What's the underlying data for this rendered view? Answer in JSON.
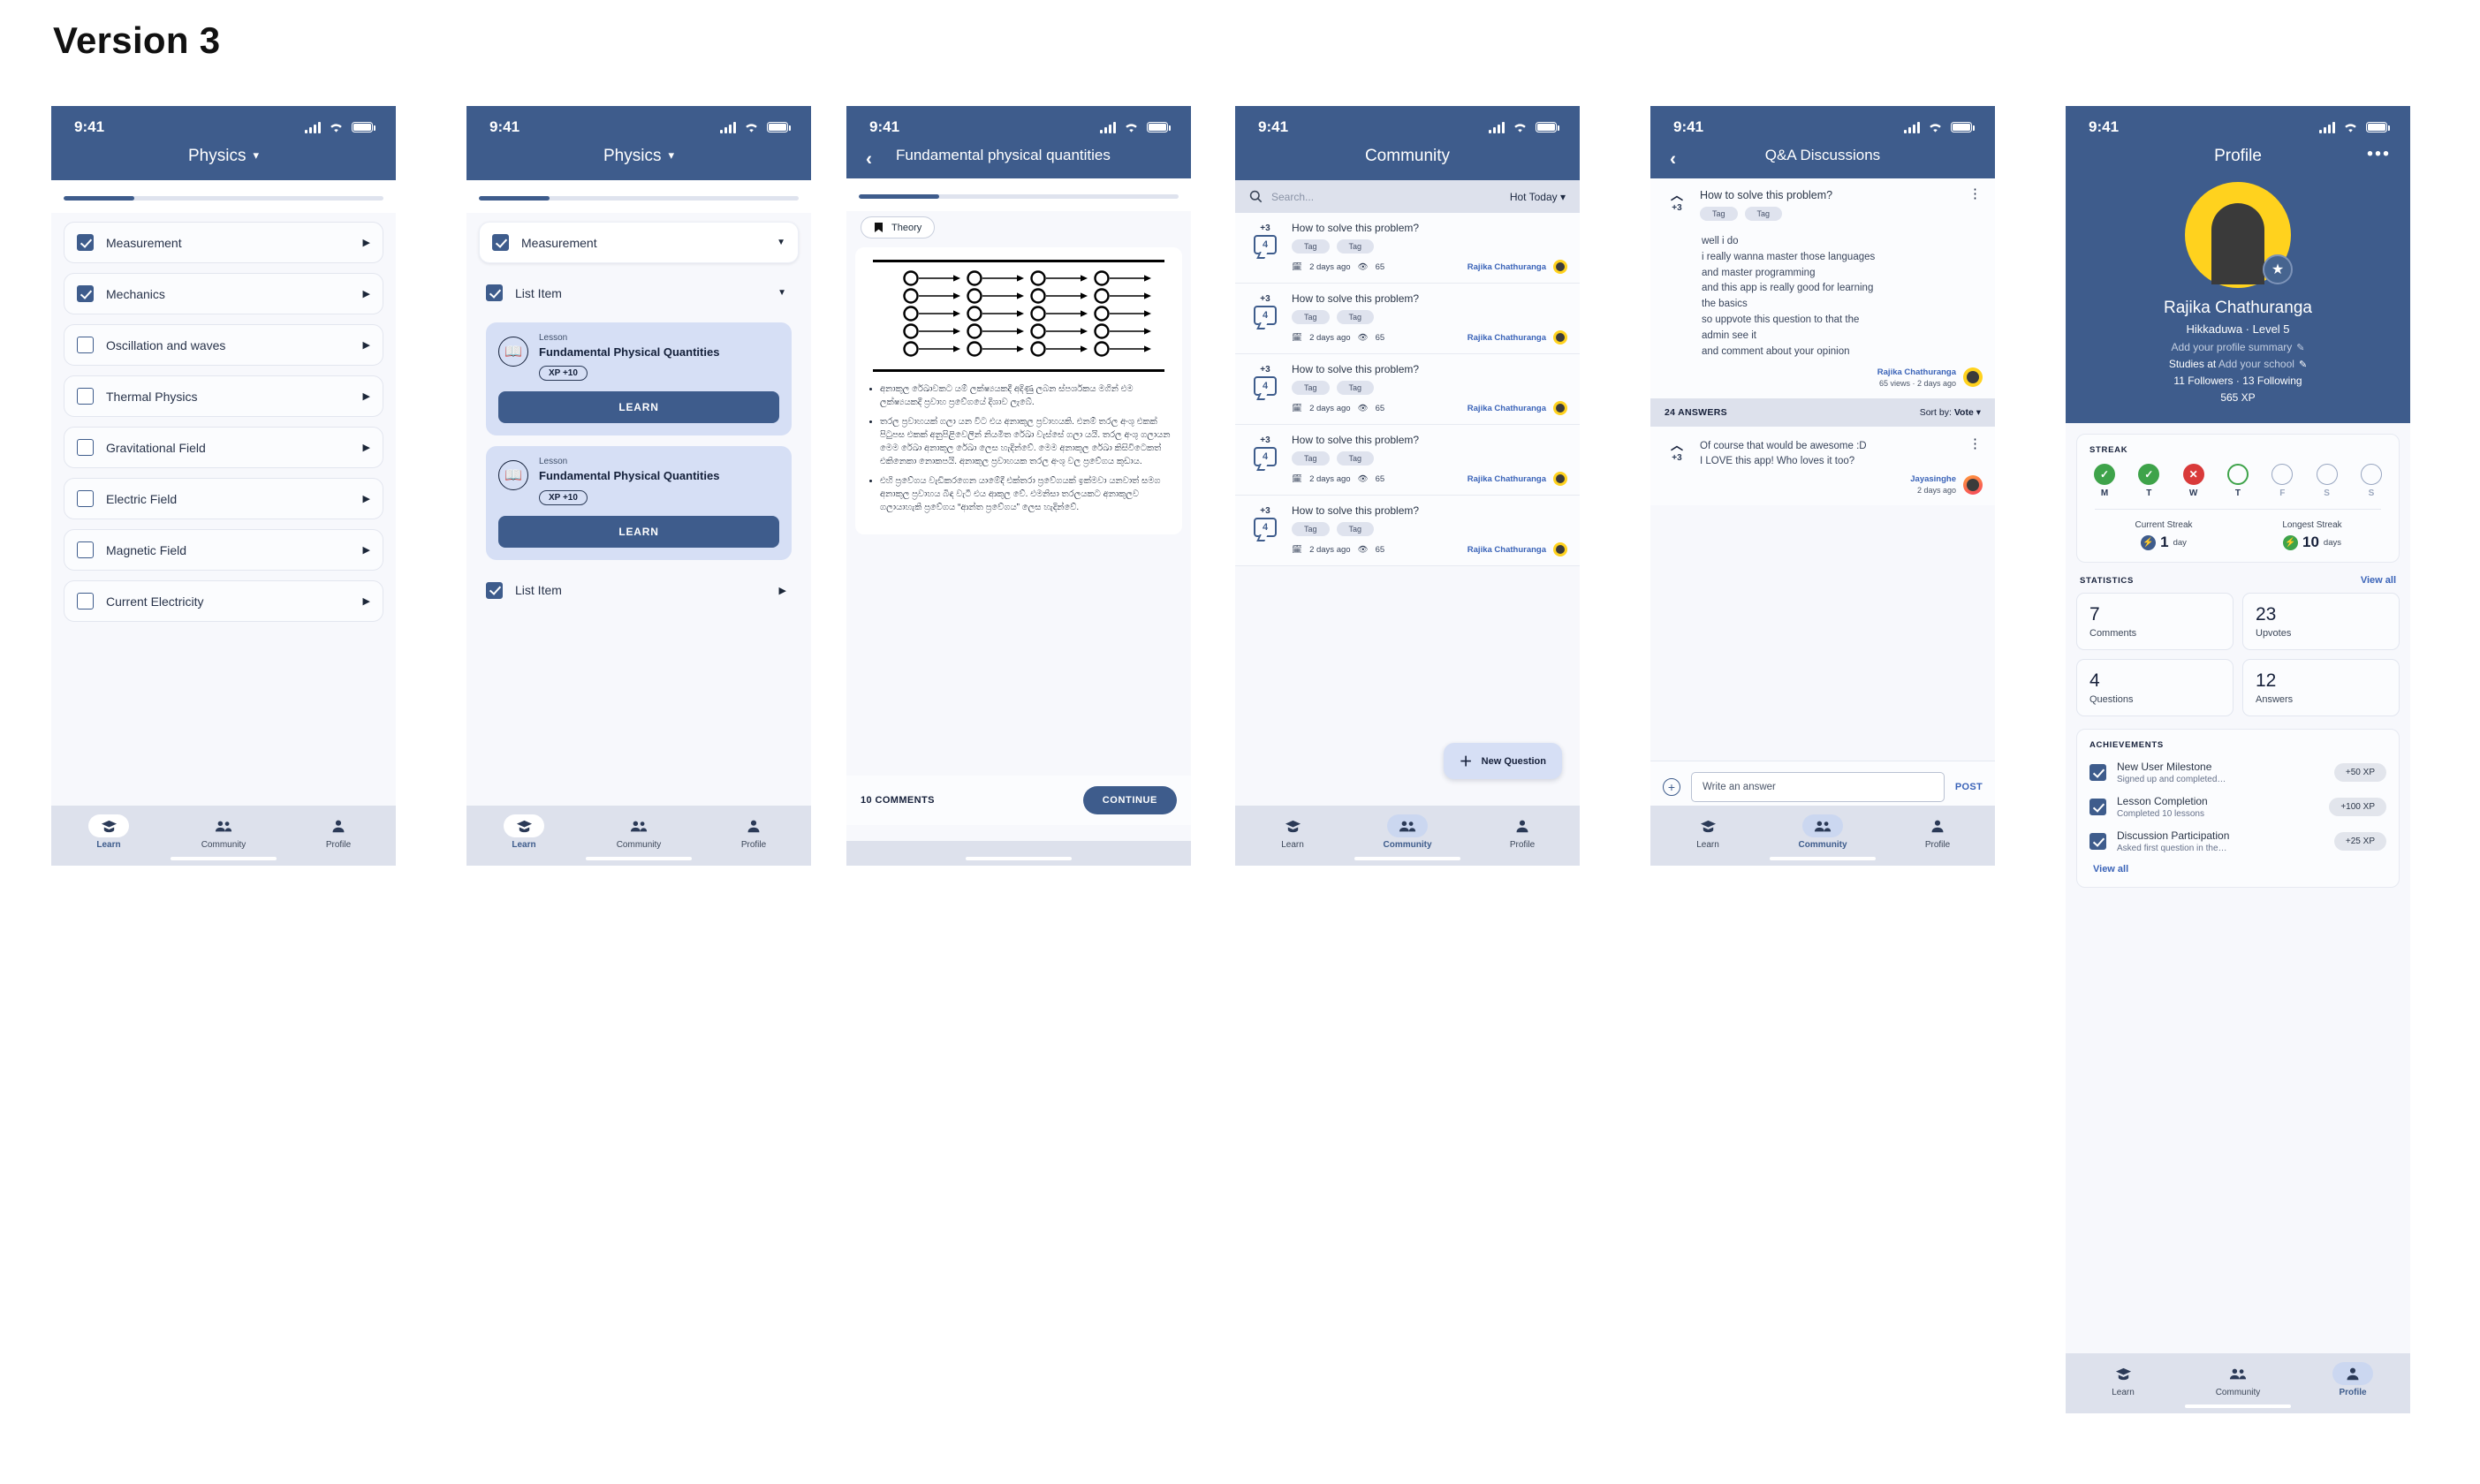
{
  "page_title": "Version 3",
  "status_bar": {
    "time": "9:41"
  },
  "screen1": {
    "title": "Physics",
    "progress_percent": 22,
    "items": [
      {
        "label": "Measurement",
        "checked": true
      },
      {
        "label": "Mechanics",
        "checked": true
      },
      {
        "label": "Oscillation and waves",
        "checked": false
      },
      {
        "label": "Thermal Physics",
        "checked": false
      },
      {
        "label": "Gravitational Field",
        "checked": false
      },
      {
        "label": "Electric Field",
        "checked": false
      },
      {
        "label": "Magnetic Field",
        "checked": false
      },
      {
        "label": "Current Electricity",
        "checked": false
      }
    ],
    "nav": [
      {
        "label": "Learn",
        "icon": "graduation-cap-icon",
        "active": true
      },
      {
        "label": "Community",
        "icon": "people-icon",
        "active": false
      },
      {
        "label": "Profile",
        "icon": "person-icon",
        "active": false
      }
    ]
  },
  "screen2": {
    "title": "Physics",
    "progress_percent": 22,
    "header_item": {
      "label": "Measurement",
      "checked": true
    },
    "list_item_1": {
      "label": "List Item",
      "checked": true
    },
    "list_item_2": {
      "label": "List Item",
      "checked": true
    },
    "lessons": [
      {
        "kicker": "Lesson",
        "name": "Fundamental Physical Quantities",
        "xp": "XP  +10",
        "button": "LEARN"
      },
      {
        "kicker": "Lesson",
        "name": "Fundamental Physical Quantities",
        "xp": "XP  +10",
        "button": "LEARN"
      }
    ],
    "nav": [
      {
        "label": "Learn",
        "icon": "graduation-cap-icon",
        "active": true
      },
      {
        "label": "Community",
        "icon": "people-icon",
        "active": false
      },
      {
        "label": "Profile",
        "icon": "person-icon",
        "active": false
      }
    ]
  },
  "screen3": {
    "title": "Fundamental physical quantities",
    "progress_percent": 25,
    "chip": "Theory",
    "bullets": [
      "අනාකුල රේඛාවකට යම් ලක්ෂ්‍යයකදී අදිණු ලබන ස්පර්ශකය මගින් එම ලක්ෂ්‍යයකදී ප්‍රවාහ ප්‍රවේගයේ දිශාව ලැබේ.",
      "තරල ප්‍රවාහයක් ගලා යන විට එය අනාකුල ප්‍රවාහයකි. එනම් තරල අංශු එකක් පිටුපස එකක් අනුපිළිවෙලින් නියමිත රේඛා වැස්සේ ගලා යයි. තරල අංශු ගලායන මෙම රේඛා අනාකුල රේඛා ලෙස හැදින්වේ. මෙම අනාකුල රේඛා කිසිවිටෙකත් එකිනෙකා නොකපයි. අනාකුල ප්‍රවාහයක තරල අංශු වල ප්‍රවේගය කුඩාය.",
      "එහි ප්‍රවේගය වැඩිකරගෙන යාමේදී එක්තරා ප්‍රවේගයක් ඉක්මවා යනවාත් සමග අනාකුල ප්‍රවාහය බිඳ වැටී එය ආකුල වේ. එමනිසා තරලයකට අනාකුලව ගලායාහැකි ප්‍රවේගය “ආන්ත ප්‍රවේගය” ලෙස හැදින්වේ."
    ],
    "comments_label": "10 COMMENTS",
    "continue_label": "CONTINUE"
  },
  "screen4": {
    "title": "Community",
    "search_placeholder": "Search...",
    "sort_label": "Hot Today",
    "fab_label": "New Question",
    "questions": [
      {
        "votes": "+3",
        "answers": "4",
        "title": "How to solve this problem?",
        "tags": [
          "Tag",
          "Tag"
        ],
        "time": "2 days ago",
        "views": "65",
        "author": "Rajika Chathuranga"
      },
      {
        "votes": "+3",
        "answers": "4",
        "title": "How to solve this problem?",
        "tags": [
          "Tag",
          "Tag"
        ],
        "time": "2 days ago",
        "views": "65",
        "author": "Rajika Chathuranga"
      },
      {
        "votes": "+3",
        "answers": "4",
        "title": "How to solve this problem?",
        "tags": [
          "Tag",
          "Tag"
        ],
        "time": "2 days ago",
        "views": "65",
        "author": "Rajika Chathuranga"
      },
      {
        "votes": "+3",
        "answers": "4",
        "title": "How to solve this problem?",
        "tags": [
          "Tag",
          "Tag"
        ],
        "time": "2 days ago",
        "views": "65",
        "author": "Rajika Chathuranga"
      },
      {
        "votes": "+3",
        "answers": "4",
        "title": "How to solve this problem?",
        "tags": [
          "Tag",
          "Tag"
        ],
        "time": "2 days ago",
        "views": "65",
        "author": "Rajika Chathuranga"
      }
    ],
    "nav": [
      {
        "label": "Learn",
        "icon": "graduation-cap-icon",
        "active": false
      },
      {
        "label": "Community",
        "icon": "people-icon",
        "active": true
      },
      {
        "label": "Profile",
        "icon": "person-icon",
        "active": false
      }
    ]
  },
  "screen5": {
    "title": "Q&A Discussions",
    "question": {
      "votes": "+3",
      "title": "How to solve this problem?",
      "tags": [
        "Tag",
        "Tag"
      ],
      "body": "well i do\ni really wanna master those languages\nand master programming\nand this app is really good for learning\nthe basics\nso uppvote this question to that the\nadmin see it\nand comment about your opinion",
      "author": "Rajika Chathuranga",
      "meta": "65 views · 2 days ago"
    },
    "answers_count_label": "24 ANSWERS",
    "sort_prefix": "Sort by:",
    "sort_value": "Vote",
    "answer": {
      "votes": "+3",
      "body": "Of course that would be awesome :D\nI LOVE this app! Who loves it too?",
      "author": "Jayasinghe",
      "meta": "2 days ago"
    },
    "write_placeholder": "Write an answer",
    "post_label": "POST",
    "nav": [
      {
        "label": "Learn",
        "icon": "graduation-cap-icon",
        "active": false
      },
      {
        "label": "Community",
        "icon": "people-icon",
        "active": true
      },
      {
        "label": "Profile",
        "icon": "person-icon",
        "active": false
      }
    ]
  },
  "screen6": {
    "title": "Profile",
    "name": "Rajika Chathuranga",
    "location_level": "Hikkaduwa · Level 5",
    "summary_placeholder": "Add your profile summary",
    "studies_prefix": "Studies at",
    "school_placeholder": "Add your school",
    "followers_line": "11 Followers · 13 Following",
    "xp": "565 XP",
    "streak": {
      "heading": "STREAK",
      "days": [
        {
          "letter": "M",
          "state": "ok"
        },
        {
          "letter": "T",
          "state": "ok"
        },
        {
          "letter": "W",
          "state": "no"
        },
        {
          "letter": "T",
          "state": "today"
        },
        {
          "letter": "F",
          "state": "empty"
        },
        {
          "letter": "S",
          "state": "empty"
        },
        {
          "letter": "S",
          "state": "empty"
        }
      ],
      "current_label": "Current Streak",
      "current_value": "1",
      "current_unit": "day",
      "longest_label": "Longest Streak",
      "longest_value": "10",
      "longest_unit": "days"
    },
    "statistics": {
      "heading": "STATISTICS",
      "view_all": "View all",
      "cards": [
        {
          "value": "7",
          "label": "Comments"
        },
        {
          "value": "23",
          "label": "Upvotes"
        },
        {
          "value": "4",
          "label": "Questions"
        },
        {
          "value": "12",
          "label": "Answers"
        }
      ]
    },
    "achievements": {
      "heading": "ACHIEVEMENTS",
      "items": [
        {
          "title": "New User Milestone",
          "desc": "Signed up and completed…",
          "xp": "+50 XP",
          "checked": true
        },
        {
          "title": "Lesson Completion",
          "desc": "Completed 10 lessons",
          "xp": "+100 XP",
          "checked": true
        },
        {
          "title": "Discussion Participation",
          "desc": "Asked first question in the…",
          "xp": "+25 XP",
          "checked": true
        }
      ],
      "view_all": "View all"
    },
    "nav": [
      {
        "label": "Learn",
        "icon": "graduation-cap-icon",
        "active": false
      },
      {
        "label": "Community",
        "icon": "people-icon",
        "active": false
      },
      {
        "label": "Profile",
        "icon": "person-icon",
        "active": true
      }
    ]
  },
  "colors": {
    "primary": "#3e5c8c",
    "accent": "#d6dff5",
    "green": "#3ea34a",
    "red": "#d93a3a",
    "yellow": "#ffd21e"
  }
}
